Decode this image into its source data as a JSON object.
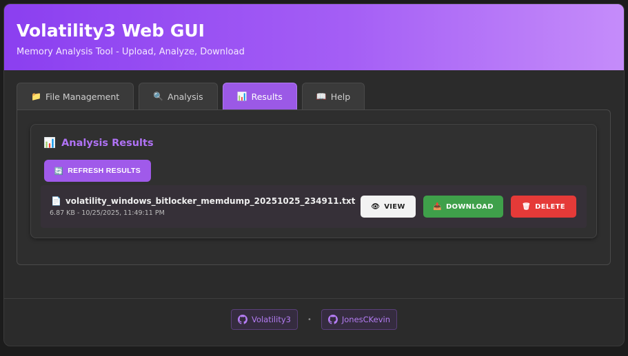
{
  "header": {
    "title": "Volatility3 Web GUI",
    "subtitle": "Memory Analysis Tool - Upload, Analyze, Download"
  },
  "tabs": [
    {
      "label": "File Management",
      "icon": "📁",
      "active": false
    },
    {
      "label": "Analysis",
      "icon": "🔍",
      "active": false
    },
    {
      "label": "Results",
      "icon": "📊",
      "active": true
    },
    {
      "label": "Help",
      "icon": "📖",
      "active": false
    }
  ],
  "results": {
    "title": "Analysis Results",
    "title_icon": "📊",
    "refresh_label": "REFRESH RESULTS",
    "refresh_icon": "🔄",
    "files": [
      {
        "icon": "📄",
        "name": "volatility_windows_bitlocker_memdump_20251025_234911.txt",
        "meta": "6.87 KB - 10/25/2025, 11:49:11 PM",
        "view_label": "VIEW",
        "view_icon": "👁",
        "download_label": "DOWNLOAD",
        "download_icon": "📥",
        "delete_label": "DELETE",
        "delete_icon": "🗑"
      }
    ]
  },
  "footer": {
    "links": [
      {
        "label": "Volatility3",
        "icon": "github-icon"
      },
      {
        "label": "JonesCKevin",
        "icon": "github-icon"
      }
    ],
    "separator": "•"
  },
  "colors": {
    "accent": "#9b59e6",
    "download": "#3fa04a",
    "delete": "#e53a38"
  }
}
